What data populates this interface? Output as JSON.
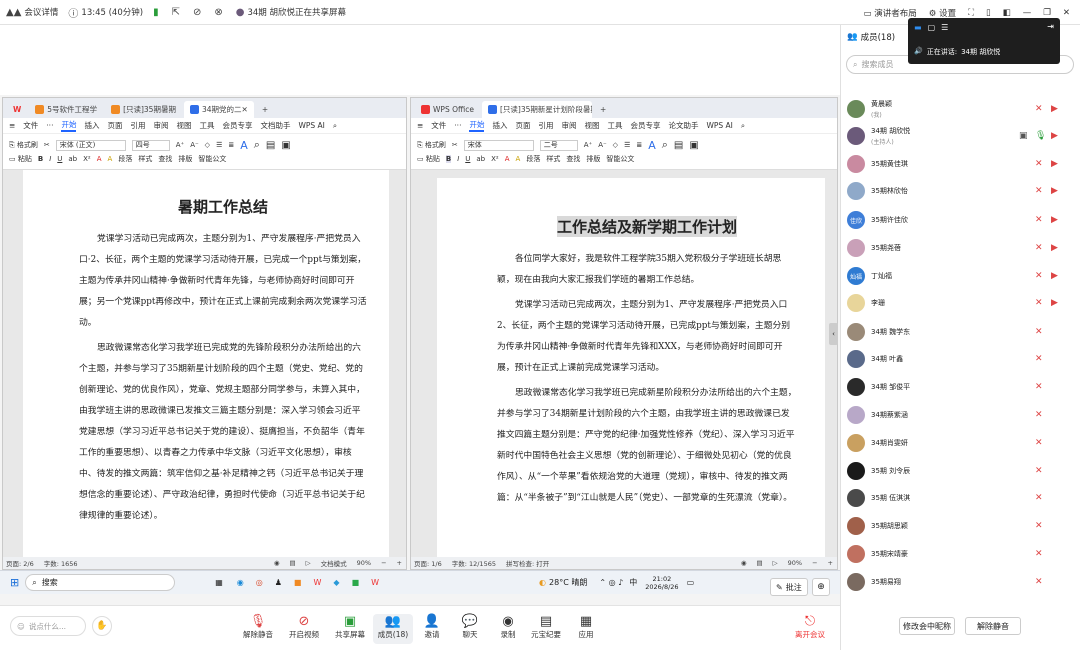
{
  "topbar": {
    "app": "会议详情",
    "time": "13:45 (40分钟)",
    "title": "34期 胡欣悦正在共享屏幕",
    "layout": "演讲者布局",
    "settings": "设置"
  },
  "speaker": {
    "label": "正在讲话:",
    "name": "34期 胡欣悦"
  },
  "left_window": {
    "tabs": [
      "5号软件工程学",
      "[只读]35期暑期",
      "34期党的二"
    ],
    "menu": [
      "文件",
      "开始",
      "插入",
      "页面",
      "引用",
      "审阅",
      "视图",
      "工具",
      "会员专享",
      "文档助手",
      "WPS AI"
    ],
    "ribbon": {
      "font": "宋体 (正文)",
      "size": "四号",
      "format_painter": "格式刷",
      "paste": "粘贴",
      "paragraph": "段落",
      "style": "样式",
      "find": "查找",
      "arrange": "排版",
      "smart": "智能公文"
    },
    "title": "暑期工作总结",
    "paras": [
      "党课学习活动已完成两次，主题分别为1、严守发展程序·严把党员入口·2、长征，两个主题的党课学习活动待开展，已完成一个ppt与策划案，主题为传承井冈山精神·争做新时代青年先锋，与老师协商好时间即可开展；另一个党课ppt再修改中，预计在正式上课前完成剩余两次党课学习活动。",
      "思政微课常态化学习我学班已完成党的先锋阶段积分办法所给出的六个主题，并参与学习了35期新星计划阶段的四个主题（党史、党纪、党的创新理论、党的优良作风），党章、党规主题部分同学参与，未算入其中，由我学班主讲的思政微课已发推文三篇主题分别是：深入学习领会习近平党建思想（学习习近平总书记关于党的建设）、挺膺担当，不负韶华（青年工作的重要思想）、以青春之力传承中华文脉（习近平文化思想），审核中、待发的推文两篇：筑牢信仰之基·补足精神之钙（习近平总书记关于理想信念的重要论述）、严守政治纪律，勇担时代使命（习近平总书记关于纪律规律的重要论述）。"
    ],
    "status": {
      "page": "页面: 2/6",
      "words": "字数: 1656",
      "zoom": "90%",
      "mode": "文档模式"
    }
  },
  "right_window": {
    "tabs": [
      "WPS Office",
      "[只读]35期新星计划阶段暑期"
    ],
    "menu": [
      "文件",
      "开始",
      "插入",
      "页面",
      "引用",
      "审阅",
      "视图",
      "工具",
      "会员专享",
      "论文助手",
      "WPS AI"
    ],
    "ribbon": {
      "font": "宋体",
      "size": "二号",
      "format_painter": "格式刷",
      "paste": "粘贴",
      "paragraph": "段落",
      "style": "样式",
      "find": "查找",
      "arrange": "排版",
      "smart": "智能公文"
    },
    "title": "工作总结及新学期工作计划",
    "paras": [
      "各位同学大家好，我是软件工程学院35期入党积极分子学班班长胡思颖，现在由我向大家汇报我们学班的暑期工作总结。",
      "党课学习活动已完成两次，主题分别为1、严守发展程序·严把党员入口2、长征，两个主题的党课学习活动待开展，已完成ppt与策划案，主题分别为传承井冈山精神·争做新时代青年先锋和XXX，与老师协商好时间即可开展，预计在正式上课前完成党课学习活动。",
      "思政微课常态化学习我学班已完成新星阶段积分办法所给出的六个主题，并参与学习了34期新星计划阶段的六个主题，由我学班主讲的思政微课已发推文四篇主题分别是：严守党的纪律·加强党性修养（党纪）、深入学习习近平新时代中国特色社会主义思想（党的创新理论）、于细微处见初心（党的优良作风）、从“一个苹果”看依规治党的大道理（党规），审核中、待发的推文两篇：从“半条被子”到“江山就是人民”（党史）、一部党章的生死漂流（党章）。"
    ],
    "status": {
      "page": "页面: 1/6",
      "words": "字数: 12/1565",
      "spell": "拼写检查: 打开",
      "zoom": "90%"
    }
  },
  "taskbar": {
    "search": "搜索",
    "weather": "28°C 晴朗",
    "ime": "中",
    "time": "21:02",
    "date": "2026/8/26"
  },
  "annotate": "批注",
  "bottom": {
    "chat_placeholder": "说点什么...",
    "tools": [
      "解除静音",
      "开启视频",
      "共享屏幕",
      "成员(18)",
      "邀请",
      "聊天",
      "录制",
      "元宝纪要",
      "应用"
    ],
    "leave": "离开会议"
  },
  "side": {
    "title": "成员(18)",
    "search_placeholder": "搜索成员",
    "members": [
      {
        "name": "黄晨颖",
        "role": "(我)",
        "color": "#6a8a5a"
      },
      {
        "name": "34期 胡欣悦",
        "role": "(主持人)",
        "color": "#6b5a7a"
      },
      {
        "name": "35期黄佳琪",
        "role": "",
        "color": "#c98aa0"
      },
      {
        "name": "35期林欣怡",
        "role": "",
        "color": "#8fa9c9"
      },
      {
        "name": "35期许佳欣",
        "role": "",
        "color": "#3e7ed8",
        "txt": "佳欣"
      },
      {
        "name": "35期尧蓓",
        "role": "",
        "color": "#c9a0b8"
      },
      {
        "name": "丁灿福",
        "role": "",
        "color": "#2f7bd2",
        "txt": "灿福"
      },
      {
        "name": "李珊",
        "role": "",
        "color": "#e8d59a"
      },
      {
        "name": "34期 魏学东",
        "role": "",
        "color": "#9a8a78"
      },
      {
        "name": "34期 叶鑫",
        "role": "",
        "color": "#5a6a8a"
      },
      {
        "name": "34期 邹俊平",
        "role": "",
        "color": "#2a2a2a"
      },
      {
        "name": "34期蔡紫涵",
        "role": "",
        "color": "#b8a8c8"
      },
      {
        "name": "34期肖雯妍",
        "role": "",
        "color": "#c9a060"
      },
      {
        "name": "35期 刘令辰",
        "role": "",
        "color": "#1a1a1a"
      },
      {
        "name": "35期 伍淇淇",
        "role": "",
        "color": "#4a4a4a"
      },
      {
        "name": "35期胡思颖",
        "role": "",
        "color": "#a0604a"
      },
      {
        "name": "35期宋靖豪",
        "role": "",
        "color": "#c07060"
      },
      {
        "name": "35期易翔",
        "role": "",
        "color": "#7a6a60"
      }
    ],
    "rename": "修改会中昵称",
    "unmute": "解除静音"
  }
}
